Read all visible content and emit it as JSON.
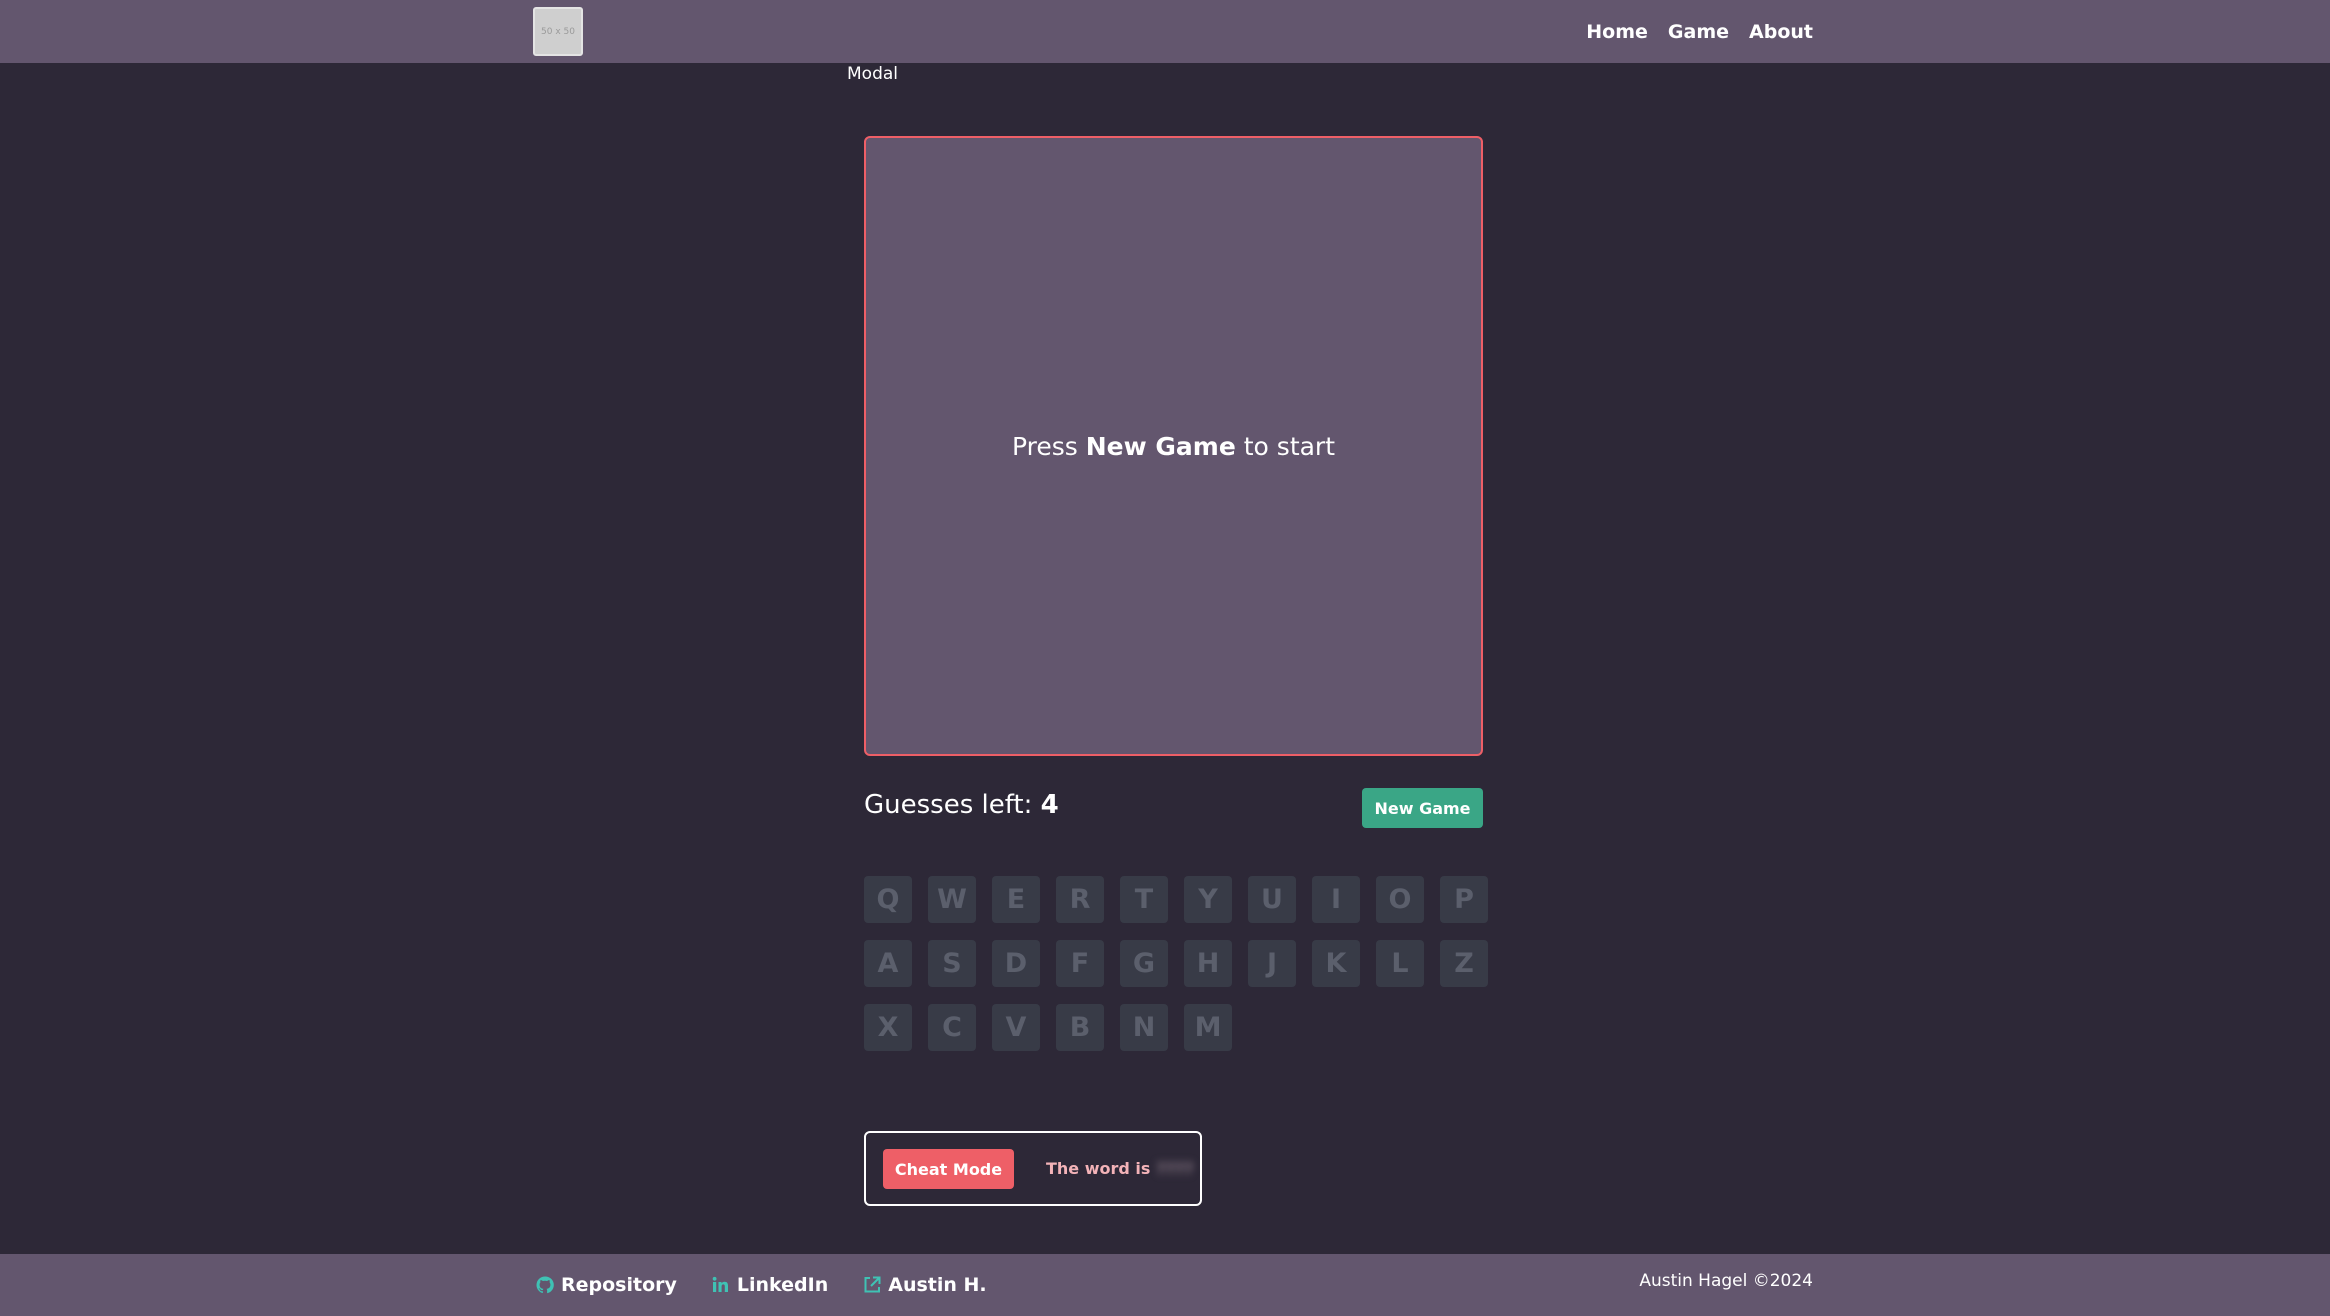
{
  "header": {
    "logo_text": "50 x 50",
    "nav": [
      "Home",
      "Game",
      "About"
    ]
  },
  "modal_label": "Modal",
  "board": {
    "pre": "Press ",
    "bold": "New Game",
    "post": " to start"
  },
  "status": {
    "guesses_label": "Guesses left: ",
    "guesses_value": "4",
    "new_game_label": "New Game"
  },
  "keyboard": {
    "row1": [
      "Q",
      "W",
      "E",
      "R",
      "T",
      "Y",
      "U",
      "I",
      "O",
      "P"
    ],
    "row2": [
      "A",
      "S",
      "D",
      "F",
      "G",
      "H",
      "J",
      "K",
      "L",
      "Z"
    ],
    "row3": [
      "X",
      "C",
      "V",
      "B",
      "N",
      "M"
    ]
  },
  "cheat": {
    "button_label": "Cheat Mode",
    "text": "The word is",
    "hidden_word": "????"
  },
  "footer": {
    "links": [
      "Repository",
      "LinkedIn",
      "Austin H."
    ],
    "copyright": "Austin Hagel ©2024"
  },
  "colors": {
    "bar": "#63566e",
    "background": "#2d2837",
    "accent_red": "#ee5f67",
    "accent_green": "#3aa686",
    "icon_teal": "#3fc2b4"
  }
}
